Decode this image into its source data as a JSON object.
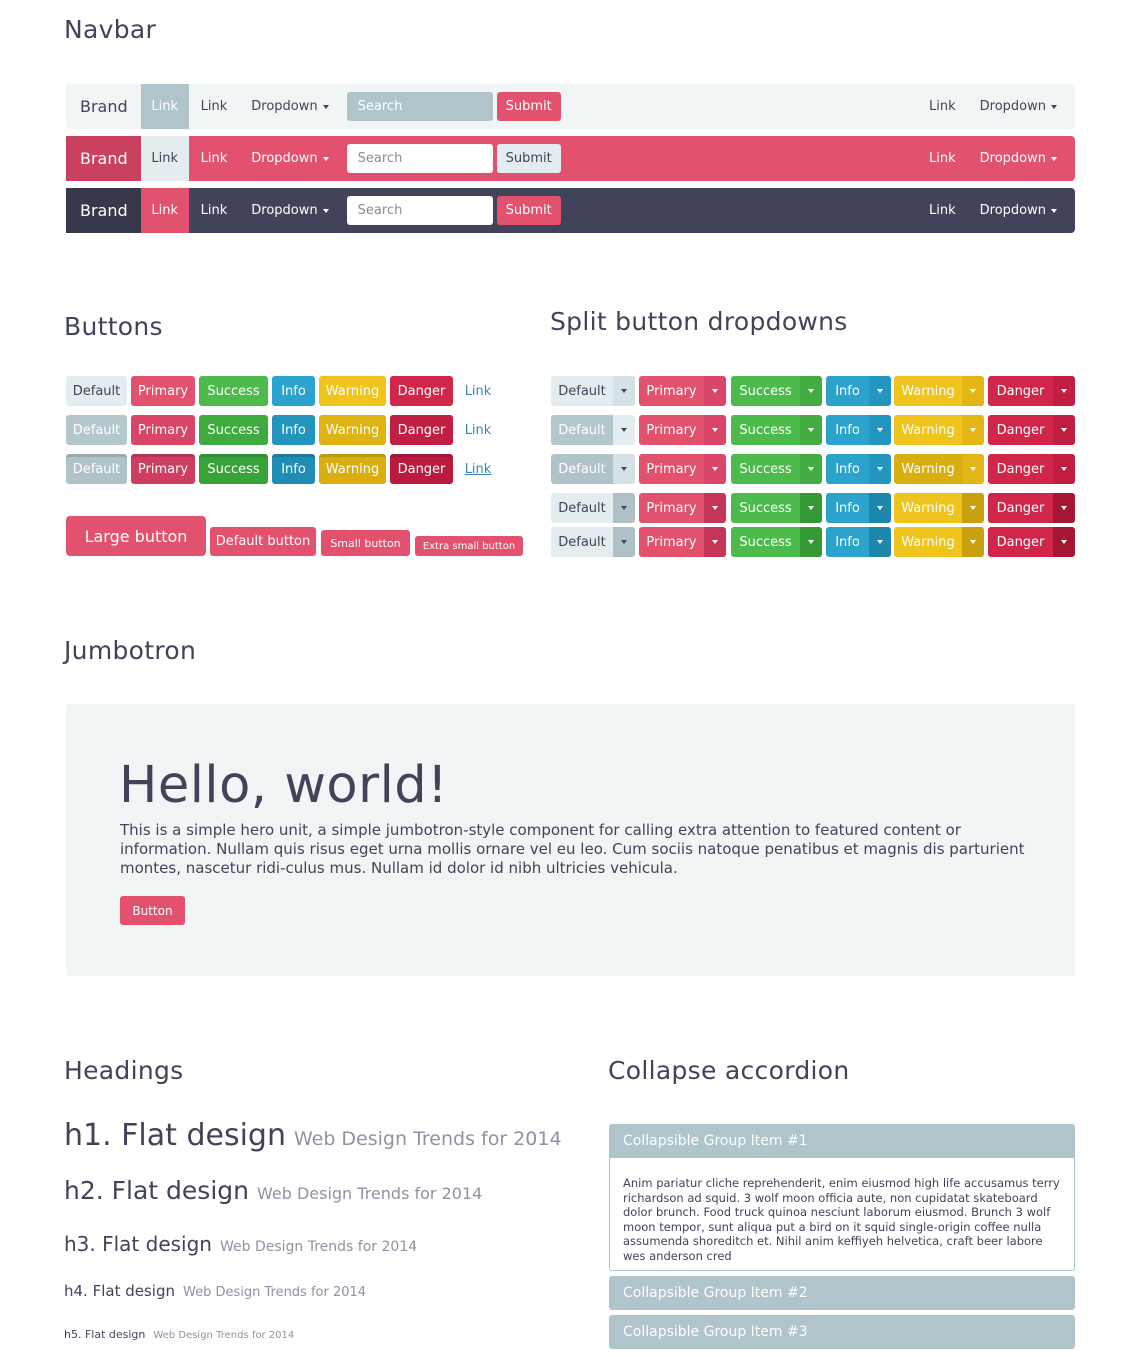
{
  "sections": {
    "navbar": "Navbar",
    "buttons": "Buttons",
    "split": "Split button dropdowns",
    "jumbotron": "Jumbotron",
    "headings": "Headings",
    "accordion": "Collapse accordion"
  },
  "navbar": {
    "brand": "Brand",
    "link_active": "Link",
    "link": "Link",
    "dropdown": "Dropdown",
    "search_placeholder": "Search",
    "submit": "Submit",
    "right_link": "Link",
    "right_dropdown": "Dropdown"
  },
  "buttons": {
    "default": "Default",
    "primary": "Primary",
    "success": "Success",
    "info": "Info",
    "warning": "Warning",
    "danger": "Danger",
    "link": "Link",
    "large": "Large button",
    "default_size": "Default button",
    "small": "Small button",
    "xsmall": "Extra small button"
  },
  "jumbotron": {
    "title": "Hello, world!",
    "text": "This is a simple hero unit, a simple jumbotron-style component for calling extra attention to featured content or information. Nullam quis risus eget urna mollis ornare vel eu leo. Cum sociis natoque penatibus et magnis dis parturient montes, nascetur ridi-culus mus. Nullam id dolor id nibh ultricies vehicula.",
    "button": "Button"
  },
  "headings": {
    "h1": "h1. Flat design",
    "h2": "h2. Flat design",
    "h3": "h3. Flat design",
    "h4": "h4. Flat design",
    "h5": "h5. Flat design",
    "sub": "Web Design Trends for 2014"
  },
  "accordion": {
    "item1": "Collapsible Group Item #1",
    "item2": "Collapsible Group Item #2",
    "item3": "Collapsible Group Item #3",
    "body": "Anim pariatur cliche reprehenderit, enim eiusmod high life accusamus terry richardson ad squid. 3 wolf moon officia aute, non cupidatat skateboard dolor brunch. Food truck quinoa nesciunt laborum eiusmod. Brunch 3 wolf moon tempor, sunt aliqua put a bird on it squid single-origin coffee nulla assumenda shoreditch et. Nihil anim keffiyeh helvetica, craft beer labore wes anderson cred"
  },
  "colors": {
    "dark": "#41435a",
    "primary": "#e2526f",
    "success": "#4cbb4c",
    "info": "#2ba3cc",
    "warning": "#eec41d",
    "danger": "#d0264a",
    "default": "#e3edef"
  }
}
